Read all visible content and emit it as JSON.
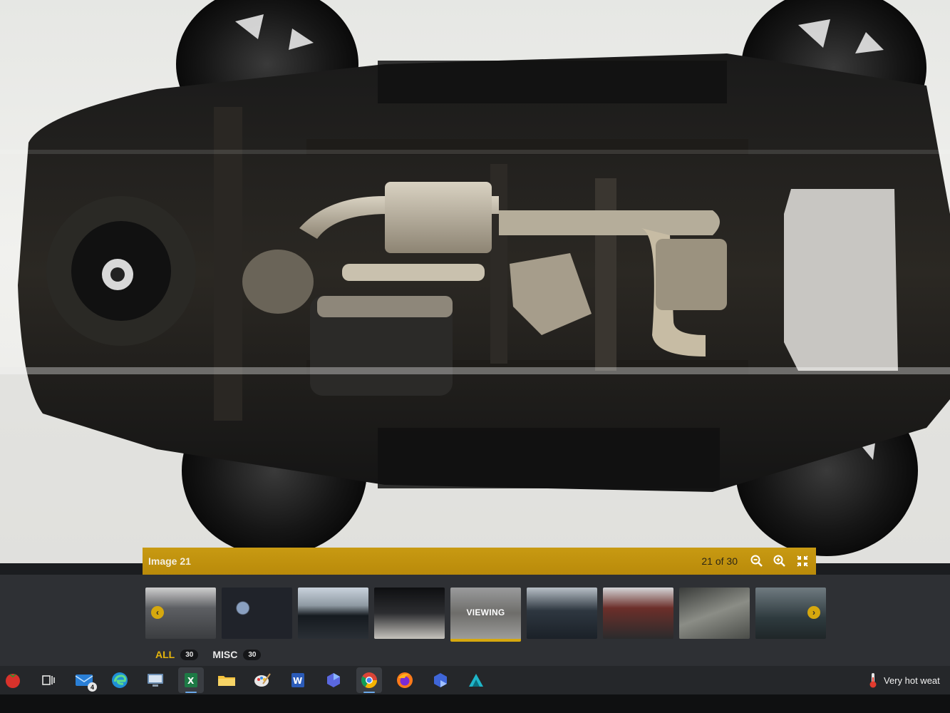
{
  "viewer": {
    "title": "Image 21",
    "counter": "21 of 30",
    "controls": [
      "zoom-out-icon",
      "zoom-in-icon",
      "fullscreen-icon"
    ]
  },
  "thumbnails": [
    {
      "name": "cargo-area",
      "label": ""
    },
    {
      "name": "instrument-cluster",
      "label": ""
    },
    {
      "name": "side-exterior",
      "label": ""
    },
    {
      "name": "interior-seat",
      "label": ""
    },
    {
      "name": "undercarriage",
      "label": "VIEWING",
      "active": true
    },
    {
      "name": "front-exterior",
      "label": ""
    },
    {
      "name": "rear-exterior",
      "label": ""
    },
    {
      "name": "side-sill",
      "label": ""
    },
    {
      "name": "windshield",
      "label": ""
    }
  ],
  "filters": [
    {
      "name": "ALL",
      "count": "30",
      "color": "#e4b40c"
    },
    {
      "name": "MISC",
      "count": "30",
      "color": "#e9e9e9"
    }
  ],
  "taskbar": {
    "icons": [
      "tomato-icon",
      "task-view-icon",
      "mail-icon",
      "edge-icon",
      "network-icon",
      "excel-icon",
      "file-explorer-icon",
      "paint-icon",
      "word-icon",
      "copilot-icon",
      "chrome-icon",
      "firefox-icon",
      "copilot-icon-2",
      "app-icon"
    ],
    "mail_badge": "4",
    "weather_text": "Very hot weat"
  },
  "colors": {
    "accent": "#c89a12",
    "strip": "#2e3034",
    "taskbar": "#25272a"
  }
}
